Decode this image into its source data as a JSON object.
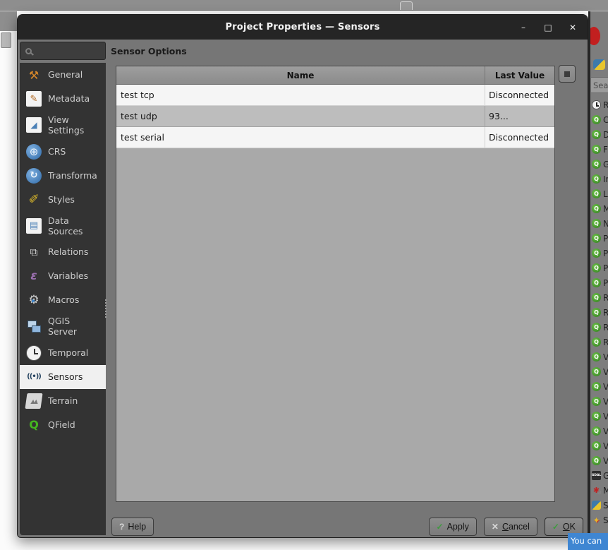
{
  "colors": {
    "accent_blue": "#3f86d2",
    "selection_bg": "#f0f0f0",
    "titlebar_bg": "#252525",
    "qgis_green": "#3f9b28"
  },
  "window": {
    "title": "Project Properties — Sensors",
    "controls": {
      "minimize": "–",
      "maximize": "□",
      "close": "✕"
    }
  },
  "toolbar": {
    "icons": [
      {
        "icon": "draw-pencil"
      },
      {
        "icon": "vertex-tool"
      },
      {
        "icon": "vertex-tool"
      },
      {
        "icon": "vertex-tool"
      },
      {
        "icon": "undo-vertex"
      },
      {
        "icon": "redo-vertex"
      },
      {
        "icon": "new-layer-star"
      },
      {
        "icon": "new-layer-star"
      },
      {
        "icon": "new-layer-star"
      },
      {
        "icon": "new-page"
      },
      {
        "icon": "temporal-clock"
      },
      {
        "icon": "refresh"
      },
      {
        "icon": "grid"
      },
      {
        "icon": "no-edits"
      },
      {
        "icon": "labels"
      },
      {
        "icon": "cursor"
      },
      {
        "icon": "dots-menu"
      },
      {
        "icon": "processing-gear",
        "selected": true
      },
      {
        "icon": "metasearch-z"
      },
      {
        "icon": "list"
      },
      {
        "icon": "ruler"
      }
    ]
  },
  "sidebar": {
    "items": [
      {
        "id": "general",
        "icon": "general",
        "label": "General"
      },
      {
        "id": "metadata",
        "icon": "metadata",
        "label": "Metadata"
      },
      {
        "id": "view-settings",
        "icon": "view-settings",
        "label": "View\nSettings"
      },
      {
        "id": "crs",
        "icon": "crs",
        "label": "CRS"
      },
      {
        "id": "transformations",
        "icon": "transformation",
        "label": "Transforma"
      },
      {
        "id": "styles",
        "icon": "styles",
        "label": "Styles"
      },
      {
        "id": "data-sources",
        "icon": "data-sources",
        "label": "Data\nSources"
      },
      {
        "id": "relations",
        "icon": "relations",
        "label": "Relations"
      },
      {
        "id": "variables",
        "icon": "variables",
        "label": "Variables"
      },
      {
        "id": "macros",
        "icon": "macros",
        "label": "Macros"
      },
      {
        "id": "qgis-server",
        "icon": "qgis-server",
        "label": "QGIS\nServer"
      },
      {
        "id": "temporal",
        "icon": "temporal",
        "label": "Temporal"
      },
      {
        "id": "sensors",
        "icon": "sensors",
        "label": "Sensors",
        "selected": true
      },
      {
        "id": "terrain",
        "icon": "terrain",
        "label": "Terrain"
      },
      {
        "id": "qfield",
        "icon": "qfield",
        "label": "QField"
      }
    ]
  },
  "main": {
    "heading": "Sensor Options",
    "table": {
      "columns": {
        "name": "Name",
        "value": "Last Value"
      },
      "rows": [
        {
          "name": "test tcp",
          "value": "Disconnected"
        },
        {
          "name": "test udp",
          "value": "93..."
        },
        {
          "name": "test serial",
          "value": "Disconnected"
        }
      ]
    },
    "buttons": {
      "help": {
        "icon": "?",
        "label": "Help"
      },
      "apply": {
        "icon": "✓",
        "label": "Apply"
      },
      "cancel": {
        "icon": "✕",
        "key": "C",
        "rest": "ancel"
      },
      "ok": {
        "icon": "✓",
        "key": "O",
        "rest": "K"
      }
    }
  },
  "right_panel": {
    "search_text": "Sea",
    "items": [
      {
        "icon": "clock",
        "letter": "R"
      },
      {
        "icon": "qgis",
        "letter": "C"
      },
      {
        "icon": "qgis",
        "letter": "D"
      },
      {
        "icon": "qgis",
        "letter": "F"
      },
      {
        "icon": "qgis",
        "letter": "G"
      },
      {
        "icon": "qgis",
        "letter": "In"
      },
      {
        "icon": "qgis",
        "letter": "L"
      },
      {
        "icon": "qgis",
        "letter": "M"
      },
      {
        "icon": "qgis",
        "letter": "N"
      },
      {
        "icon": "qgis",
        "letter": "P"
      },
      {
        "icon": "qgis",
        "letter": "P"
      },
      {
        "icon": "qgis",
        "letter": "P"
      },
      {
        "icon": "qgis",
        "letter": "P"
      },
      {
        "icon": "qgis",
        "letter": "R"
      },
      {
        "icon": "qgis",
        "letter": "R"
      },
      {
        "icon": "qgis",
        "letter": "R"
      },
      {
        "icon": "qgis",
        "letter": "R"
      },
      {
        "icon": "qgis",
        "letter": "V"
      },
      {
        "icon": "qgis",
        "letter": "V"
      },
      {
        "icon": "qgis",
        "letter": "V"
      },
      {
        "icon": "qgis",
        "letter": "V"
      },
      {
        "icon": "qgis",
        "letter": "V"
      },
      {
        "icon": "qgis",
        "letter": "V"
      },
      {
        "icon": "qgis",
        "letter": "V"
      },
      {
        "icon": "qgis",
        "letter": "V"
      },
      {
        "icon": "gdal",
        "letter": "G"
      },
      {
        "icon": "models",
        "letter": "M"
      },
      {
        "icon": "python",
        "letter": "S"
      },
      {
        "icon": "brush",
        "letter": "S"
      }
    ]
  },
  "statusbar": {
    "text": "You can"
  }
}
